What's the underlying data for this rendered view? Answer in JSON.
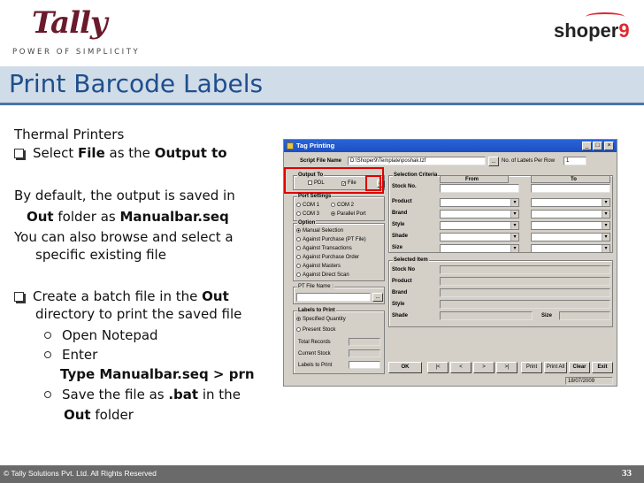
{
  "header": {
    "logo_text": "Tally",
    "tagline": "POWER OF SIMPLICITY",
    "brand_right": "shoper",
    "brand_right_num": "9"
  },
  "title": "Print Barcode Labels",
  "body": {
    "line1": "Thermal Printers",
    "bullet1_pre": "Select ",
    "bullet1_b1": "File",
    "bullet1_mid": " as the ",
    "bullet1_b2": "Output to",
    "line2": "By default, the output is saved in",
    "line3_b": "Out",
    "line3_mid": " folder as ",
    "line3_b2": "Manualbar.seq",
    "line4": "You can also browse and select a",
    "line5": "specific existing file",
    "bullet2_pre": "Create a batch file in the ",
    "bullet2_b": "Out",
    "line6": "directory to print the saved file",
    "sub1": "Open Notepad",
    "sub2": "Enter",
    "sub2_b": "Type Manualbar.seq > prn",
    "sub3_pre": "Save the file as ",
    "sub3_b": ".bat",
    "sub3_post": " in the",
    "sub3b_b": "Out",
    "sub3b_post": " folder"
  },
  "footer": {
    "copyright": "© Tally Solutions Pvt. Ltd. All Rights Reserved",
    "page": "33"
  },
  "dialog": {
    "title": "Tag Printing",
    "script_label": "Script File Name",
    "script_value": "D:\\Shoper9\\Template\\poshak.tzf",
    "browse": "...",
    "labels_per_row_label": "No. of Labels Per Row",
    "labels_per_row_value": "1",
    "output_to": "Output To",
    "pdl": "PDL",
    "file": "File",
    "port_settings": "Port Settings",
    "com1": "COM 1",
    "com2": "COM 2",
    "com3": "COM 3",
    "parallel": "Parallel Port",
    "option": "Option",
    "opt1": "Manual Selection",
    "opt2": "Against Purchase (PT File)",
    "opt3": "Against Transactions",
    "opt4": "Against Purchase Order",
    "opt5": "Against Masters",
    "opt6": "Against Direct Scan",
    "pt_file": "PT File Name :",
    "labels_to_print": "Labels to Print",
    "ltp1": "Specified Quantity",
    "ltp2": "Present Stock",
    "total_records": "Total Records",
    "current_stock": "Current Stock",
    "labels_print": "Labels to Print",
    "sel_criteria": "Selection Criteria",
    "from": "From",
    "to": "To",
    "c_stock": "Stock No.",
    "c_product": "Product",
    "c_brand": "Brand",
    "c_style": "Style",
    "c_shade": "Shade",
    "c_size": "Size",
    "sel_item": "Selected Item",
    "si_stock": "Stock No",
    "si_product": "Product",
    "si_brand": "Brand",
    "si_style": "Style",
    "si_shade": "Shade",
    "si_size": "Size",
    "btn_ok": "OK",
    "btn_first": "|<",
    "btn_prev": "<",
    "btn_next": ">",
    "btn_last": ">|",
    "btn_print": "Print",
    "btn_printall": "Print All",
    "btn_clear": "Clear",
    "btn_exit": "Exit",
    "date": "18/07/2009"
  }
}
